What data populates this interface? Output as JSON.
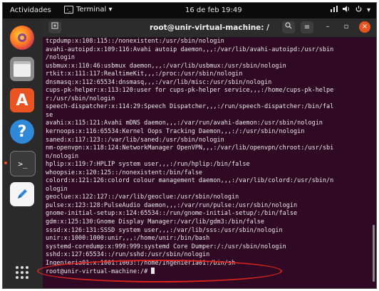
{
  "topbar": {
    "activities": "Actividades",
    "app_menu": "Terminal ▾",
    "clock": "16 de feb  19:49",
    "tray": [
      "network-icon",
      "volume-icon",
      "power-icon"
    ]
  },
  "dock": {
    "items": [
      "firefox-icon",
      "files-icon",
      "software-icon",
      "help-icon",
      "terminal-icon",
      "text-editor-icon",
      "apps-grid-icon"
    ],
    "software_glyph": "A",
    "help_glyph": "?",
    "terminal_glyph": ">_"
  },
  "window": {
    "title": "root@unir-virtual-machine: /"
  },
  "terminal": {
    "lines": [
      "tcpdump:x:108:115::/nonexistent:/usr/sbin/nologin",
      "avahi-autoipd:x:109:116:Avahi autoip daemon,,,:/var/lib/avahi-autoipd:/usr/sbin",
      "/nologin",
      "usbmux:x:110:46:usbmux daemon,,,:/var/lib/usbmux:/usr/sbin/nologin",
      "rtkit:x:111:117:RealtimeKit,,,:/proc:/usr/sbin/nologin",
      "dnsmasq:x:112:65534:dnsmasq,,,:/var/lib/misc:/usr/sbin/nologin",
      "cups-pk-helper:x:113:120:user for cups-pk-helper service,,,:/home/cups-pk-helpe",
      "r:/usr/sbin/nologin",
      "speech-dispatcher:x:114:29:Speech Dispatcher,,,:/run/speech-dispatcher:/bin/fal",
      "se",
      "avahi:x:115:121:Avahi mDNS daemon,,,:/var/run/avahi-daemon:/usr/sbin/nologin",
      "kernoops:x:116:65534:Kernel Oops Tracking Daemon,,,:/:/usr/sbin/nologin",
      "saned:x:117:123::/var/lib/saned:/usr/sbin/nologin",
      "nm-openvpn:x:118:124:NetworkManager OpenVPN,,,:/var/lib/openvpn/chroot:/usr/sbi",
      "n/nologin",
      "hplip:x:119:7:HPLIP system user,,,:/run/hplip:/bin/false",
      "whoopsie:x:120:125::/nonexistent:/bin/false",
      "colord:x:121:126:colord colour management daemon,,,:/var/lib/colord:/usr/sbin/n",
      "ologin",
      "geoclue:x:122:127::/var/lib/geoclue:/usr/sbin/nologin",
      "pulse:x:123:128:PulseAudio daemon,,,:/var/run/pulse:/usr/sbin/nologin",
      "gnome-initial-setup:x:124:65534::/run/gnome-initial-setup/:/bin/false",
      "gdm:x:125:130:Gnome Display Manager:/var/lib/gdm3:/bin/false",
      "sssd:x:126:131:SSSD system user,,,:/var/lib/sss:/usr/sbin/nologin",
      "unir:x:1000:1000:unir,,,:/home/unir:/bin/bash",
      "systemd-coredump:x:999:999:systemd Core Dumper:/:/usr/sbin/nologin",
      "sshd:x:127:65534::/run/sshd:/usr/sbin/nologin",
      "Ingenieria01:x:1001:1003::/home/Ingenieria01:/bin/sh"
    ],
    "prompt": "root@unir-virtual-machine:/# "
  },
  "colors": {
    "accent": "#e95420",
    "terminal_bg": "#300a24",
    "annotation": "#d9241c"
  }
}
